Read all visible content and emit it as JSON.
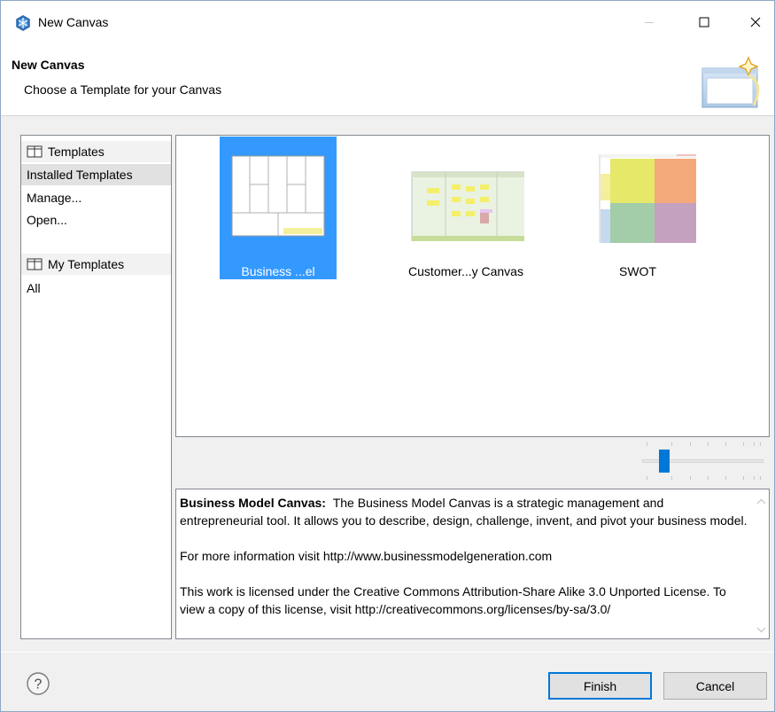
{
  "window": {
    "title": "New Canvas"
  },
  "banner": {
    "title": "New Canvas",
    "subtitle": "Choose a Template for your Canvas"
  },
  "nav": {
    "sections": [
      {
        "header": "Templates",
        "items": [
          "Installed Templates",
          "Manage...",
          "Open..."
        ]
      },
      {
        "header": "My Templates",
        "items": [
          "All"
        ]
      }
    ],
    "selected": "Installed Templates"
  },
  "templates": [
    {
      "label": "Business ...el Canvas",
      "selected": true
    },
    {
      "label": "Customer...y Canvas",
      "selected": false
    },
    {
      "label": "SWOT",
      "selected": false
    }
  ],
  "zoom": {
    "level": 0.15
  },
  "description": {
    "heading": "Business Model Canvas:",
    "intro": "The Business Model Canvas is a strategic management and entrepreneurial tool. It allows you to describe, design, challenge, invent, and pivot your business model.",
    "more_info": "For more information visit http://www.businessmodelgeneration.com",
    "license": "This work is licensed under the Creative Commons Attribution-Share Alike 3.0 Unported License. To view a copy of this license, visit http://creativecommons.org/licenses/by-sa/3.0/"
  },
  "buttons": {
    "finish": "Finish",
    "cancel": "Cancel"
  },
  "colors": {
    "selection": "#3399ff",
    "accent": "#0078d7"
  }
}
